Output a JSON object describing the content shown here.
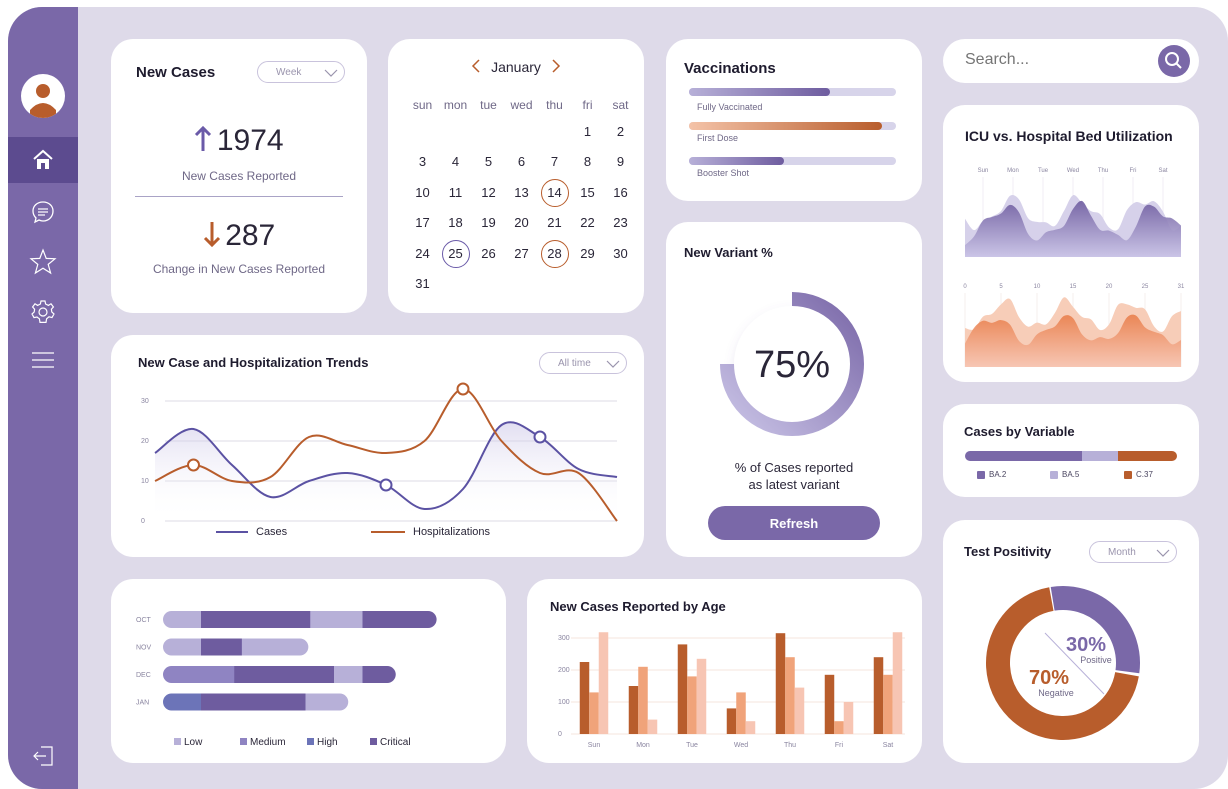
{
  "sidebar": {
    "items": [
      {
        "icon": "home-icon",
        "active": true
      },
      {
        "icon": "chat-icon",
        "active": false
      },
      {
        "icon": "star-icon",
        "active": false
      },
      {
        "icon": "gear-icon",
        "active": false
      },
      {
        "icon": "menu-icon",
        "active": false
      }
    ],
    "logout_icon": "logout-icon"
  },
  "new_cases": {
    "title": "New Cases",
    "period": "Week",
    "value": "1974",
    "value_label": "New Cases Reported",
    "change": "287",
    "change_label": "Change in New Cases Reported"
  },
  "calendar": {
    "month": "January",
    "weekdays": [
      "sun",
      "mon",
      "tue",
      "wed",
      "thu",
      "fri",
      "sat"
    ],
    "first_weekday": 5,
    "days_in_month": 31,
    "highlight_orange": [
      14,
      28
    ],
    "highlight_purple": [
      25
    ]
  },
  "vaccinations": {
    "title": "Vaccinations",
    "items": [
      {
        "label": "Fully Vaccinated",
        "fraction": 0.68
      },
      {
        "label": "First Dose",
        "fraction": 0.93
      },
      {
        "label": "Booster Shot",
        "fraction": 0.46
      }
    ]
  },
  "variant": {
    "title": "New Variant %",
    "value": "75%",
    "fraction": 0.75,
    "description_line1": "% of Cases reported",
    "description_line2": "as latest variant",
    "button": "Refresh"
  },
  "search": {
    "placeholder": "Search..."
  },
  "trends": {
    "title": "New Case and Hospitalization Trends",
    "period": "All time",
    "legend": [
      "Cases",
      "Hospitalizations"
    ]
  },
  "age": {
    "title": "New Cases Reported by Age"
  },
  "icu": {
    "title": "ICU vs. Hospital Bed Utilization",
    "top_ticks": [
      "Sun",
      "Mon",
      "Tue",
      "Wed",
      "Thu",
      "Fri",
      "Sat"
    ],
    "mid_ticks": [
      "0",
      "5",
      "10",
      "15",
      "20",
      "25",
      "31"
    ]
  },
  "variables": {
    "title": "Cases by Variable",
    "segments": [
      {
        "label": "BA.2",
        "fraction": 0.55,
        "color": "#7a68a8"
      },
      {
        "label": "BA.5",
        "fraction": 0.17,
        "color": "#b7b0d8"
      },
      {
        "label": "C.37",
        "fraction": 0.28,
        "color": "#b85d2c"
      }
    ]
  },
  "positivity": {
    "title": "Test Positivity",
    "period": "Month",
    "positive_value": "30%",
    "positive_label": "Positive",
    "negative_value": "70%",
    "negative_label": "Negative",
    "positive_fraction": 0.3
  },
  "chart_data": [
    {
      "type": "line",
      "title": "New Case and Hospitalization Trends",
      "ylim": [
        0,
        30
      ],
      "yticks": [
        "0",
        "10",
        "20",
        "30"
      ],
      "grid": true,
      "legend_position": "bottom",
      "x": [
        0,
        1,
        2,
        3,
        4,
        5,
        6,
        7,
        8,
        9,
        10,
        11,
        12
      ],
      "series": [
        {
          "name": "Cases",
          "color": "#5b52a3",
          "values": [
            17,
            23,
            14,
            6,
            10,
            12,
            9,
            3,
            8,
            24,
            21,
            13,
            11
          ]
        },
        {
          "name": "Hospitalizations",
          "color": "#b85d2c",
          "values": [
            10,
            14,
            10,
            11,
            21,
            19,
            17,
            20,
            33,
            20,
            12,
            12,
            0
          ]
        }
      ]
    },
    {
      "type": "bar",
      "orientation": "horizontal",
      "stacked": true,
      "categories": [
        "OCT",
        "NOV",
        "DEC",
        "JAN"
      ],
      "series": [
        {
          "name": "Low",
          "color": "#b7b0d8",
          "values": [
            40,
            40,
            0,
            0
          ]
        },
        {
          "name": "Medium",
          "color": "#8f84c2",
          "values": [
            0,
            0,
            75,
            0
          ]
        },
        {
          "name": "High",
          "color": "#6c74b8",
          "values": [
            0,
            0,
            0,
            40
          ]
        },
        {
          "name": "Critical",
          "color": "#6e5c9f",
          "values": [
            115,
            43,
            105,
            110
          ]
        },
        {
          "name": "Low",
          "color": "#b7b0d8",
          "values": [
            55,
            70,
            30,
            45
          ]
        },
        {
          "name": "Critical",
          "color": "#6e5c9f",
          "values": [
            78,
            0,
            35,
            0
          ]
        }
      ],
      "legend": [
        "Low",
        "Medium",
        "High",
        "Critical"
      ],
      "legend_colors": [
        "#b7b0d8",
        "#8f84c2",
        "#6c74b8",
        "#6e5c9f"
      ]
    },
    {
      "type": "bar",
      "title": "New Cases Reported by Age",
      "categories": [
        "Sun",
        "Mon",
        "Tue",
        "Wed",
        "Thu",
        "Fri",
        "Sat"
      ],
      "ylim": [
        0,
        300
      ],
      "yticks": [
        "0",
        "100",
        "200",
        "300"
      ],
      "series": [
        {
          "color": "#b85d2c",
          "values": [
            225,
            150,
            280,
            80,
            315,
            185,
            240
          ]
        },
        {
          "color": "#f0a37a",
          "values": [
            130,
            210,
            180,
            130,
            240,
            40,
            185
          ]
        },
        {
          "color": "#f7c5b3",
          "values": [
            318,
            45,
            235,
            40,
            145,
            100,
            318
          ]
        }
      ]
    }
  ]
}
